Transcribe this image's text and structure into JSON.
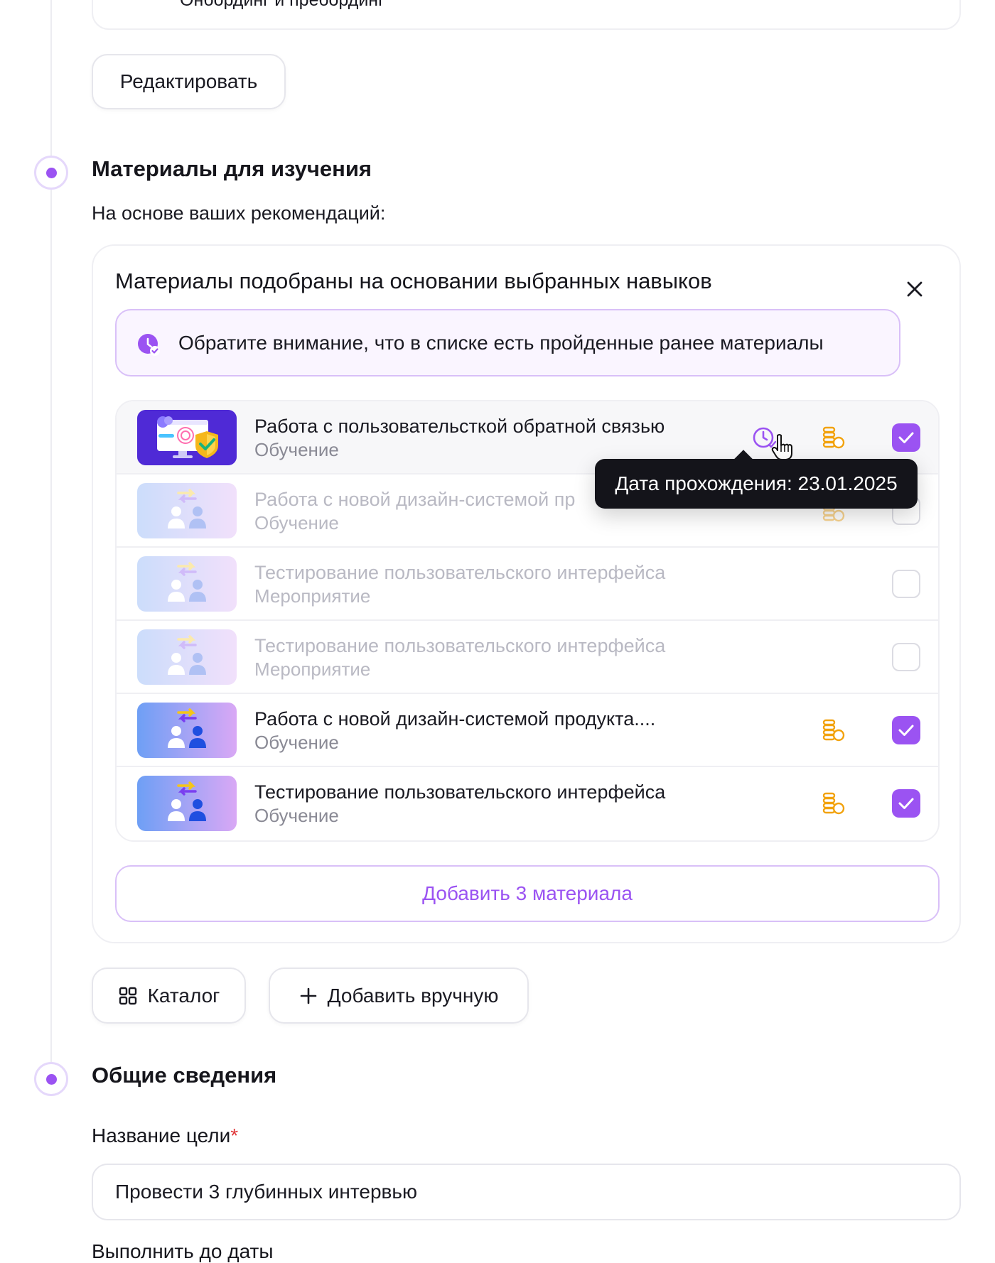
{
  "onboarding_card": {
    "text": "Онбординг и пребординг"
  },
  "edit_button": {
    "label": "Редактировать"
  },
  "materials_section": {
    "heading": "Материалы для изучения",
    "subheading": "На основе ваших рекомендаций:",
    "card_title": "Материалы подобраны на основании выбранных навыков",
    "notice_text": "Обратите внимание, что в списке есть пройденные ранее материалы",
    "tooltip": "Дата прохождения: 23.01.2025",
    "items": [
      {
        "title": "Работа с пользовательсткой обратной связью",
        "type": "Обучение",
        "checked": true,
        "completed_before": true,
        "dimmed": false
      },
      {
        "title": "Работа с новой дизайн-системой пр",
        "type": "Обучение",
        "checked": false,
        "dimmed": true
      },
      {
        "title": "Тестирование пользовательского интерфейса",
        "type": "Мероприятие",
        "checked": false,
        "dimmed": true
      },
      {
        "title": "Тестирование пользовательского интерфейса",
        "type": "Мероприятие",
        "checked": false,
        "dimmed": true
      },
      {
        "title": "Работа с новой дизайн-системой продукта....",
        "type": "Обучение",
        "checked": true,
        "dimmed": false
      },
      {
        "title": "Тестирование пользовательского интерфейса",
        "type": "Обучение",
        "checked": true,
        "dimmed": false
      }
    ],
    "add_button": "Добавить 3 материала"
  },
  "actions": {
    "catalog": "Каталог",
    "add_manual": "Добавить вручную"
  },
  "general_section": {
    "heading": "Общие сведения",
    "goal_label": "Название цели",
    "required_mark": "*",
    "goal_value": "Провести 3 глубинных интервью",
    "due_label": "Выполнить до даты"
  },
  "colors": {
    "accent": "#9b53f2",
    "coin": "#f2a20c",
    "tooltip_bg": "#14141a"
  },
  "icons": [
    "close-icon",
    "history-icon",
    "coins-icon",
    "checkbox-icon",
    "grid-icon",
    "plus-icon",
    "cursor-icon"
  ]
}
